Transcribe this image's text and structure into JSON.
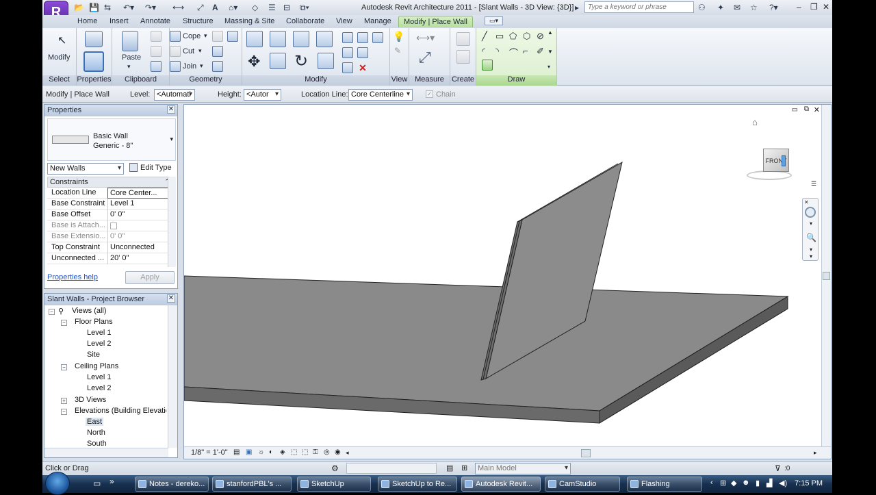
{
  "app": {
    "title": "Autodesk Revit Architecture 2011 - [Slant Walls - 3D View: {3D}]",
    "search_placeholder": "Type a keyword or phrase"
  },
  "tabs": [
    "Home",
    "Insert",
    "Annotate",
    "Structure",
    "Massing & Site",
    "Collaborate",
    "View",
    "Manage",
    "Modify | Place Wall"
  ],
  "ribbon": {
    "select_label": "Select",
    "modify_label": "Modify",
    "properties_panel": "Properties",
    "properties_btn": "Properties",
    "clipboard": "Clipboard",
    "paste": "Paste",
    "geometry": "Geometry",
    "cope": "Cope",
    "cut": "Cut",
    "join": "Join",
    "modify_panel": "Modify",
    "view": "View",
    "measure": "Measure",
    "create": "Create",
    "draw": "Draw"
  },
  "optbar": {
    "context": "Modify | Place Wall",
    "level_label": "Level:",
    "level_value": "<Automati",
    "height_label": "Height:",
    "height_value": "<Autor",
    "location_label": "Location Line:",
    "location_value": "Core Centerline",
    "chain": "Chain"
  },
  "properties": {
    "title": "Properties",
    "type_name": "Basic Wall",
    "type_sub": "Generic - 8\"",
    "instance": "New Walls",
    "edit_type": "Edit Type",
    "section": "Constraints",
    "rows": [
      {
        "k": "Location Line",
        "v": "Core Center..."
      },
      {
        "k": "Base Constraint",
        "v": "Level 1"
      },
      {
        "k": "Base Offset",
        "v": "0'  0\""
      },
      {
        "k": "Base is Attach...",
        "v": ""
      },
      {
        "k": "Base Extensio...",
        "v": "0'  0\""
      },
      {
        "k": "Top Constraint",
        "v": "Unconnected"
      },
      {
        "k": "Unconnected ...",
        "v": "20'  0\""
      }
    ],
    "help": "Properties help",
    "apply": "Apply"
  },
  "browser": {
    "title": "Slant Walls - Project Browser",
    "views": "Views (all)",
    "floor": "Floor Plans",
    "fl1": "Level 1",
    "fl2": "Level 2",
    "site": "Site",
    "ceiling": "Ceiling Plans",
    "cl1": "Level 1",
    "cl2": "Level 2",
    "threed": "3D Views",
    "elev": "Elevations (Building Elevatio",
    "east": "East",
    "north": "North",
    "south": "South"
  },
  "viewport": {
    "scale": "1/8\" = 1'-0\"",
    "viewcube": "FRONT"
  },
  "status": {
    "text": "Click or Drag",
    "model": "Main Model",
    "filter": ":0"
  },
  "taskbar": {
    "items": [
      "Notes - dereko...",
      "stanfordPBL's ...",
      "SketchUp",
      "SketchUp to Re...",
      "Autodesk Revit...",
      "CamStudio",
      "Flashing"
    ],
    "clock": "7:15 PM"
  }
}
